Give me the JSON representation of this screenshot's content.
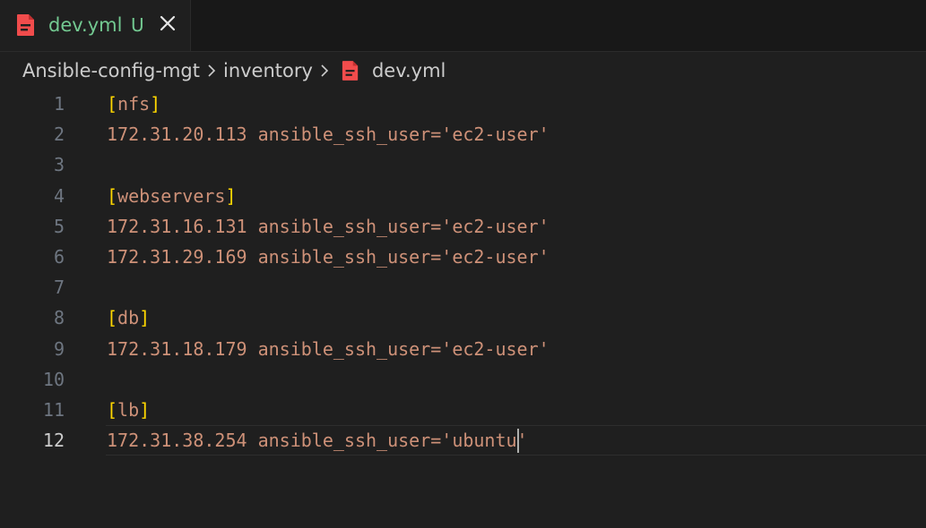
{
  "tab": {
    "filename": "dev.yml",
    "status": "U",
    "icon": "yaml-file-icon",
    "close_icon": "close-icon"
  },
  "breadcrumb": {
    "items": [
      "Ansible-config-mgt",
      "inventory",
      "dev.yml"
    ],
    "separator_icon": "chevron-right-icon",
    "file_icon": "yaml-file-icon"
  },
  "editor": {
    "active_line": 12,
    "lines": [
      {
        "num": "1",
        "text": "nfs",
        "kind": "section"
      },
      {
        "num": "2",
        "text": "172.31.20.113 ansible_ssh_user='ec2-user'",
        "kind": "code"
      },
      {
        "num": "3",
        "text": "",
        "kind": "blank"
      },
      {
        "num": "4",
        "text": "webservers",
        "kind": "section"
      },
      {
        "num": "5",
        "text": "172.31.16.131 ansible_ssh_user='ec2-user'",
        "kind": "code"
      },
      {
        "num": "6",
        "text": "172.31.29.169 ansible_ssh_user='ec2-user'",
        "kind": "code"
      },
      {
        "num": "7",
        "text": "",
        "kind": "blank"
      },
      {
        "num": "8",
        "text": "db",
        "kind": "section"
      },
      {
        "num": "9",
        "text": "172.31.18.179 ansible_ssh_user='ec2-user'",
        "kind": "code"
      },
      {
        "num": "10",
        "text": "",
        "kind": "blank"
      },
      {
        "num": "11",
        "text": "lb",
        "kind": "section"
      },
      {
        "num": "12",
        "text": "172.31.38.254 ansible_ssh_user='ubuntu'",
        "kind": "code"
      }
    ]
  },
  "colors": {
    "string": "#ce9178",
    "bracket": "#ffd700",
    "untracked": "#73c991",
    "file_icon": "#f14c4c"
  }
}
